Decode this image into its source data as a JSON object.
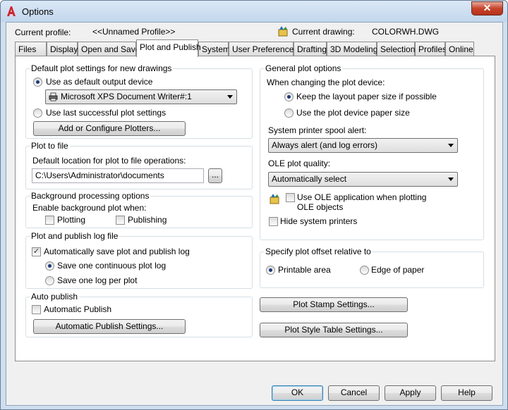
{
  "window": {
    "title": "Options"
  },
  "header": {
    "current_profile_label": "Current profile:",
    "current_profile_value": "<<Unnamed Profile>>",
    "current_drawing_label": "Current drawing:",
    "current_drawing_value": "COLORWH.DWG"
  },
  "tabs": [
    {
      "label": "Files"
    },
    {
      "label": "Display"
    },
    {
      "label": "Open and Save"
    },
    {
      "label": "Plot and Publish",
      "active": true
    },
    {
      "label": "System"
    },
    {
      "label": "User Preferences"
    },
    {
      "label": "Drafting"
    },
    {
      "label": "3D Modeling"
    },
    {
      "label": "Selection"
    },
    {
      "label": "Profiles"
    },
    {
      "label": "Online"
    }
  ],
  "default_plot": {
    "title": "Default plot settings for new drawings",
    "use_default_label": "Use as default output device",
    "device_value": "Microsoft XPS Document Writer#:1",
    "use_last_label": "Use last successful plot settings",
    "add_plotters_label": "Add or Configure Plotters..."
  },
  "plot_to_file": {
    "title": "Plot to file",
    "location_label": "Default location for plot to file operations:",
    "location_value": "C:\\Users\\Administrator\\documents",
    "browse_label": "..."
  },
  "background": {
    "title": "Background processing options",
    "enable_label": "Enable background plot when:",
    "plotting_label": "Plotting",
    "publishing_label": "Publishing"
  },
  "log": {
    "title": "Plot and publish log file",
    "auto_save_label": "Automatically save plot and publish log",
    "continuous_label": "Save one continuous plot log",
    "per_plot_label": "Save one log per plot"
  },
  "auto_publish": {
    "title": "Auto publish",
    "automatic_label": "Automatic Publish",
    "settings_label": "Automatic Publish Settings..."
  },
  "general": {
    "title": "General plot options",
    "changing_label": "When changing the plot device:",
    "keep_layout_label": "Keep the layout paper size if possible",
    "use_device_label": "Use the plot device paper size",
    "spool_label": "System printer spool alert:",
    "spool_value": "Always alert (and log errors)",
    "ole_quality_label": "OLE plot quality:",
    "ole_quality_value": "Automatically select",
    "use_ole_app_label": "Use OLE application when plotting OLE objects",
    "hide_printers_label": "Hide system printers"
  },
  "offset": {
    "title": "Specify plot offset relative to",
    "printable_label": "Printable area",
    "edge_label": "Edge of paper"
  },
  "buttons": {
    "stamp": "Plot Stamp Settings...",
    "style_table": "Plot Style Table Settings...",
    "ok": "OK",
    "cancel": "Cancel",
    "apply": "Apply",
    "help": "Help"
  }
}
